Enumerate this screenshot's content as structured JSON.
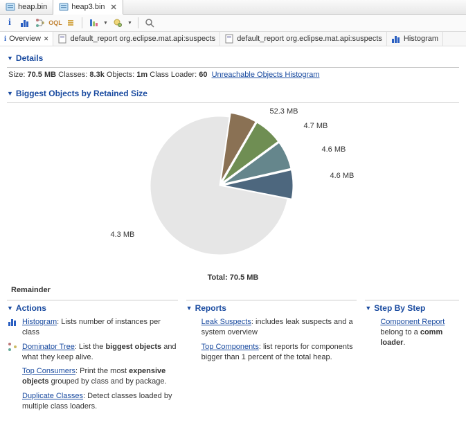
{
  "tabs": {
    "heap": "heap.bin",
    "heap3": "heap3.bin"
  },
  "subtabs": {
    "overview": "Overview",
    "report1": "default_report  org.eclipse.mat.api:suspects",
    "report2": "default_report  org.eclipse.mat.api:suspects",
    "histogram": "Histogram"
  },
  "details": {
    "title": "Details",
    "size_label": "Size: ",
    "size": "70.5 MB",
    "classes_label": " Classes: ",
    "classes": "8.3k",
    "objects_label": " Objects: ",
    "objects": "1m",
    "loader_label": " Class Loader: ",
    "loader": "60",
    "link": "Unreachable Objects Histogram"
  },
  "biggest": {
    "title": "Biggest Objects by Retained Size"
  },
  "chart_data": {
    "type": "pie",
    "total_label": "Total: 70.5 MB",
    "slices": [
      {
        "label": "52.3 MB",
        "value": 52.3,
        "color": "#e6e6e6"
      },
      {
        "label": "4.7 MB",
        "value": 4.7,
        "color": "#4d677e"
      },
      {
        "label": "4.6 MB",
        "value": 4.6,
        "color": "#65868c"
      },
      {
        "label": "4.6 MB",
        "value": 4.6,
        "color": "#6f8e53"
      },
      {
        "label": "4.3 MB",
        "value": 4.3,
        "color": "#8a7154"
      }
    ]
  },
  "remainder": "Remainder",
  "actions": {
    "title": "Actions",
    "histogram_link": "Histogram",
    "histogram_txt": ": Lists number of instances per class",
    "dom_link": "Dominator Tree",
    "dom_txt1": ": List the ",
    "dom_b": "biggest objects",
    "dom_txt2": " and what they keep alive.",
    "top_link": "Top Consumers",
    "top_txt1": ": Print the most ",
    "top_b": "expensive objects",
    "top_txt2": " grouped by class and by package.",
    "dup_link": "Duplicate Classes",
    "dup_txt": ": Detect classes loaded by multiple class loaders."
  },
  "reports": {
    "title": "Reports",
    "leak_link": "Leak Suspects",
    "leak_txt": ": includes leak suspects and a system overview",
    "topc_link": "Top Components",
    "topc_txt": ": list reports for components bigger than 1 percent of the total heap."
  },
  "steps": {
    "title": "Step By Step",
    "comp_link": "Component Report",
    "comp_txt1": " belong to a ",
    "comp_b": "comm",
    "comp_txt2": " ",
    "comp_b2": "loader",
    "comp_txt3": "."
  }
}
